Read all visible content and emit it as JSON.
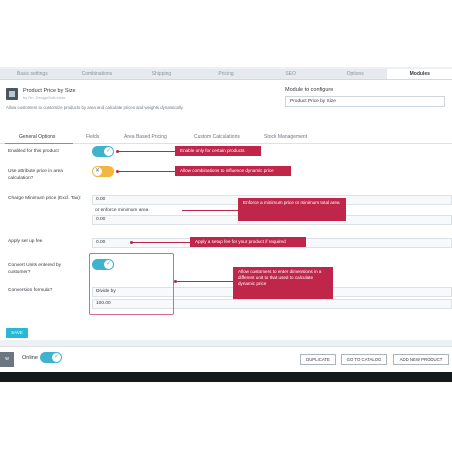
{
  "top_tabs": [
    "Basic settings",
    "Combinations",
    "Shipping",
    "Pricing",
    "SEO",
    "Options",
    "Modules"
  ],
  "module": {
    "title": "Product Price by Size",
    "author": "by Dn, DesignSoft-store",
    "description": "Allow customers to customize products by area and calculate prices and weights dynamically.",
    "configure_label": "Module to configure",
    "configure_value": "Product Price by Size"
  },
  "sub_tabs": [
    "General Options",
    "Fields",
    "Area Based Pricing",
    "Custom Calculations",
    "Stock Management"
  ],
  "fields": {
    "enabled_label": "Enabled for this product",
    "attr_price_label": "Use attribute price in area calculation?",
    "min_price_label": "Charge Minimum price (Excl. Tax):",
    "min_price_value": "0.00",
    "min_area_label": "or enforce minimum area",
    "min_area_value": "0.00",
    "setup_fee_label": "Apply set up fee",
    "setup_fee_value": "0.00",
    "convert_units_label": "Convert Units entered by customer?",
    "conversion_label": "Conversion formula?",
    "divide_by_label": "Divide by",
    "divide_by_value": "100.00"
  },
  "callouts": {
    "enable": "Enable only for certain products",
    "combinations": "Allow combinations to influence dynamic price",
    "minimum": "Enforce a minimum price or minimum total area",
    "setup": "Apply a setup fee for your product if required",
    "convert": "Allow customers to enter dimensions in a different unit to that used to calculate dynamic price"
  },
  "save_label": "SAVE",
  "footer": {
    "prev_label": "w",
    "online_label": "Online",
    "duplicate_label": "DUPLICATE",
    "catalog_label": "GO TO CATALOG",
    "add_label": "ADD NEW PRODUCT"
  },
  "colors": {
    "accent": "#25b9d7",
    "callout": "#c0254a",
    "toggle_off": "#f3b63e"
  }
}
